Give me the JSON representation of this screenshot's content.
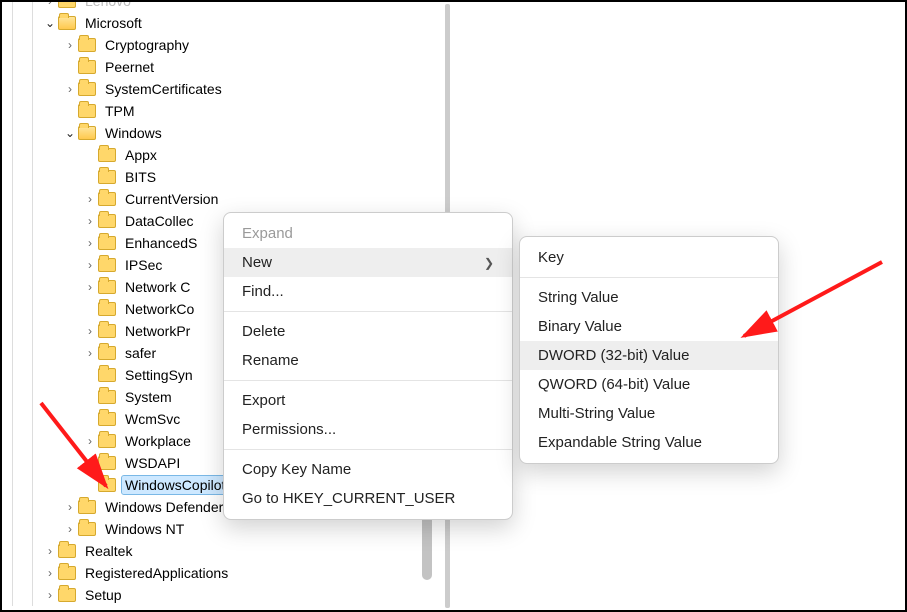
{
  "tree": [
    {
      "depth": 2,
      "twisty": ">",
      "open": false,
      "label": "Lenovo",
      "faded": true
    },
    {
      "depth": 2,
      "twisty": "v",
      "open": true,
      "label": "Microsoft"
    },
    {
      "depth": 3,
      "twisty": ">",
      "open": false,
      "label": "Cryptography"
    },
    {
      "depth": 3,
      "twisty": "",
      "open": false,
      "label": "Peernet"
    },
    {
      "depth": 3,
      "twisty": ">",
      "open": false,
      "label": "SystemCertificates"
    },
    {
      "depth": 3,
      "twisty": "",
      "open": false,
      "label": "TPM"
    },
    {
      "depth": 3,
      "twisty": "v",
      "open": true,
      "label": "Windows"
    },
    {
      "depth": 4,
      "twisty": "",
      "open": false,
      "label": "Appx"
    },
    {
      "depth": 4,
      "twisty": "",
      "open": false,
      "label": "BITS"
    },
    {
      "depth": 4,
      "twisty": ">",
      "open": false,
      "label": "CurrentVersion"
    },
    {
      "depth": 4,
      "twisty": ">",
      "open": false,
      "label": "DataCollec"
    },
    {
      "depth": 4,
      "twisty": ">",
      "open": false,
      "label": "EnhancedS"
    },
    {
      "depth": 4,
      "twisty": ">",
      "open": false,
      "label": "IPSec"
    },
    {
      "depth": 4,
      "twisty": ">",
      "open": false,
      "label": "Network C"
    },
    {
      "depth": 4,
      "twisty": "",
      "open": false,
      "label": "NetworkCo"
    },
    {
      "depth": 4,
      "twisty": ">",
      "open": false,
      "label": "NetworkPr"
    },
    {
      "depth": 4,
      "twisty": ">",
      "open": false,
      "label": "safer"
    },
    {
      "depth": 4,
      "twisty": "",
      "open": false,
      "label": "SettingSyn"
    },
    {
      "depth": 4,
      "twisty": "",
      "open": false,
      "label": "System"
    },
    {
      "depth": 4,
      "twisty": "",
      "open": false,
      "label": "WcmSvc"
    },
    {
      "depth": 4,
      "twisty": ">",
      "open": false,
      "label": "Workplace"
    },
    {
      "depth": 4,
      "twisty": "",
      "open": false,
      "label": "WSDAPI"
    },
    {
      "depth": 4,
      "twisty": "",
      "open": false,
      "label": "WindowsCopilot",
      "selected": true
    },
    {
      "depth": 3,
      "twisty": ">",
      "open": false,
      "label": "Windows Defender"
    },
    {
      "depth": 3,
      "twisty": ">",
      "open": false,
      "label": "Windows NT"
    },
    {
      "depth": 2,
      "twisty": ">",
      "open": false,
      "label": "Realtek"
    },
    {
      "depth": 2,
      "twisty": ">",
      "open": false,
      "label": "RegisteredApplications"
    },
    {
      "depth": 2,
      "twisty": ">",
      "open": false,
      "label": "Setup"
    }
  ],
  "menu_main": {
    "expand": {
      "label": "Expand",
      "disabled": true
    },
    "new": {
      "label": "New",
      "highlight": true,
      "submenu": true
    },
    "find": {
      "label": "Find..."
    },
    "delete": {
      "label": "Delete"
    },
    "rename": {
      "label": "Rename"
    },
    "export": {
      "label": "Export"
    },
    "perm": {
      "label": "Permissions..."
    },
    "copykey": {
      "label": "Copy Key Name"
    },
    "goto": {
      "label": "Go to HKEY_CURRENT_USER"
    }
  },
  "menu_sub": {
    "key": {
      "label": "Key"
    },
    "string": {
      "label": "String Value"
    },
    "binary": {
      "label": "Binary Value"
    },
    "dword": {
      "label": "DWORD (32-bit) Value",
      "highlight": true
    },
    "qword": {
      "label": "QWORD (64-bit) Value"
    },
    "multi": {
      "label": "Multi-String Value"
    },
    "expand": {
      "label": "Expandable String Value"
    }
  }
}
